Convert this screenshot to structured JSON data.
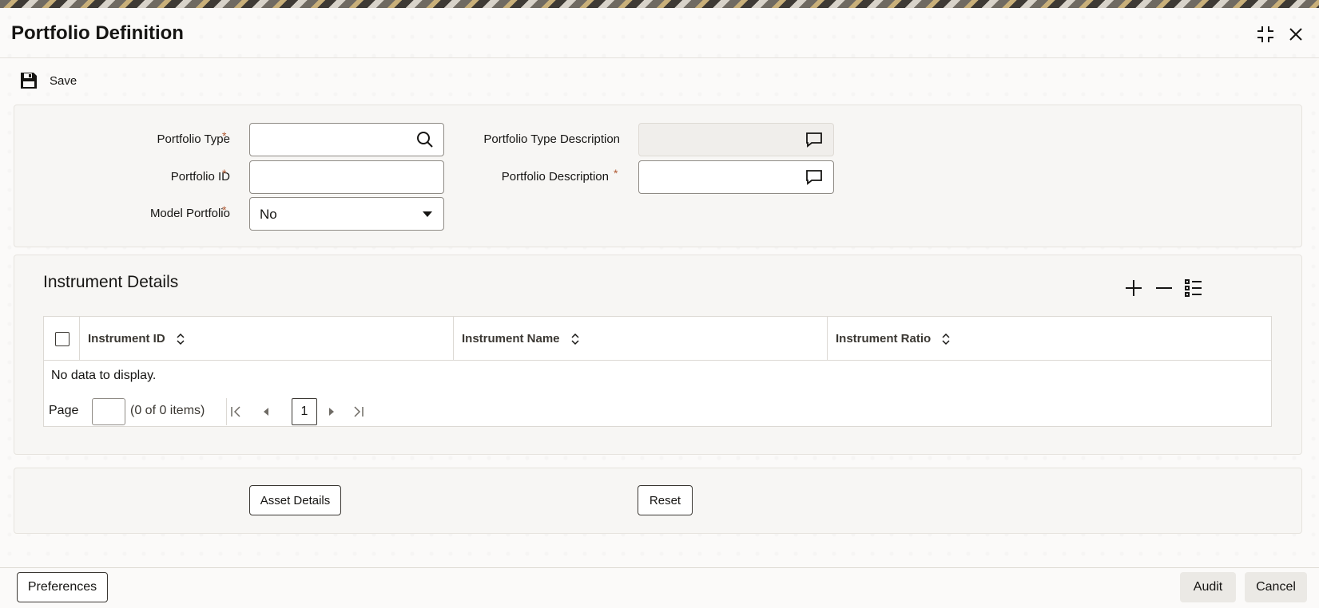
{
  "window": {
    "title": "Portfolio Definition",
    "maximize_icon": "maximize-icon",
    "close_icon": "close-icon"
  },
  "toolbar": {
    "save_label": "Save",
    "save_icon": "floppy-disk-icon"
  },
  "form": {
    "portfolio_type": {
      "label": "Portfolio Type",
      "required": "*",
      "value": "",
      "icon": "search-icon"
    },
    "portfolio_id": {
      "label": "Portfolio ID",
      "required": "*",
      "value": ""
    },
    "model_portfolio": {
      "label": "Model Portfolio",
      "required": "*",
      "value": "No",
      "options": [
        "No"
      ]
    },
    "portfolio_type_description": {
      "label": "Portfolio Type Description",
      "value": "",
      "icon": "speech-bubble-icon"
    },
    "portfolio_description": {
      "label": "Portfolio Description",
      "required": "*",
      "value": "",
      "icon": "speech-bubble-icon"
    }
  },
  "instrument_details": {
    "title": "Instrument Details",
    "tools": [
      "add-icon",
      "remove-icon",
      "column-settings-icon"
    ],
    "columns": [
      "Instrument ID",
      "Instrument Name",
      "Instrument Ratio"
    ],
    "rows": [],
    "empty_message": "No data to display.",
    "pager": {
      "label": "Page",
      "page_input": "",
      "count_text": "(0 of 0 items)",
      "current_page": "1"
    }
  },
  "actions": {
    "asset_details": "Asset Details",
    "reset": "Reset"
  },
  "footer": {
    "preferences": "Preferences",
    "audit": "Audit",
    "cancel": "Cancel"
  }
}
